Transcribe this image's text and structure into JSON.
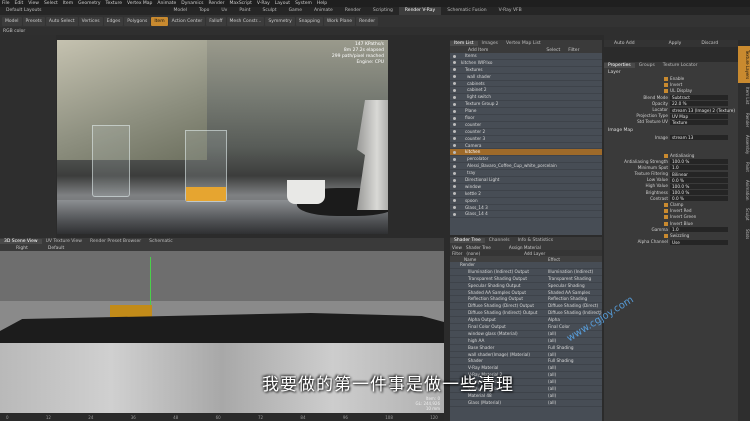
{
  "menubar": [
    "File",
    "Edit",
    "View",
    "Select",
    "Item",
    "Geometry",
    "Texture",
    "Vertex Map",
    "Animate",
    "Dynamics",
    "Render",
    "MaxScript",
    "V-Ray",
    "Layout",
    "System",
    "Help"
  ],
  "tabs": [
    "Model",
    "Topo",
    "Uv",
    "Paint",
    "Sculpt",
    "Game",
    "Animate",
    "Render",
    "Scripting",
    "Render V-Ray",
    "Schematic Fusion",
    "V-Ray VFB"
  ],
  "active_tab": "Render V-Ray",
  "layout_label": "Default Layouts",
  "toolbar": [
    {
      "label": "Model",
      "on": false
    },
    {
      "label": "Presets",
      "on": false
    },
    {
      "label": "Auto Select",
      "on": false
    },
    {
      "label": "Vertices",
      "on": false
    },
    {
      "label": "Edges",
      "on": false
    },
    {
      "label": "Polygons",
      "on": false
    },
    {
      "label": "Item",
      "on": true
    },
    {
      "label": "Action Center",
      "on": false
    },
    {
      "label": "Falloff",
      "on": false
    },
    {
      "label": "Mesh Constr...",
      "on": false
    },
    {
      "label": "Symmetry",
      "on": false
    },
    {
      "label": "Snapping",
      "on": false
    },
    {
      "label": "Work Plane",
      "on": false
    },
    {
      "label": "Render",
      "on": false
    }
  ],
  "left_label": "RGB color",
  "render_info": {
    "line1": "147 KPaths/s",
    "line2": "8m 27.2s elapsed",
    "line3": "299 path/pixel reached",
    "line4": "Engine: CPU"
  },
  "viewport_tabs": [
    "3D Scene View",
    "UV Texture View",
    "Render Preset Browser",
    "Schematic"
  ],
  "viewport_labels": {
    "view": "Right",
    "shading": "Default"
  },
  "viewport_stats": {
    "line1": "Item: 0",
    "line2": "GL: 244,926",
    "line3": "10 mm"
  },
  "ruler_ticks": [
    "0",
    "12",
    "24",
    "36",
    "48",
    "60",
    "72",
    "84",
    "96",
    "108",
    "120"
  ],
  "itemlist_tabs": [
    "Item List",
    "Images",
    "Vertex Map List"
  ],
  "itemlist_buttons": {
    "add": "Add Item",
    "select": "Select",
    "filter": "Filter"
  },
  "items": [
    {
      "name": "Items",
      "sel": false
    },
    {
      "name": "kitchen WIP.lxo",
      "sel": false
    },
    {
      "name": "Textures",
      "sel": false
    },
    {
      "name": "wall shader",
      "sel": false
    },
    {
      "name": "cabinets",
      "sel": false
    },
    {
      "name": "cabinet 2",
      "sel": false
    },
    {
      "name": "light switch",
      "sel": false
    },
    {
      "name": "Texture Group 2",
      "sel": false
    },
    {
      "name": "Plane",
      "sel": false
    },
    {
      "name": "floor",
      "sel": false
    },
    {
      "name": "counter",
      "sel": false
    },
    {
      "name": "counter 2",
      "sel": false
    },
    {
      "name": "counter 3",
      "sel": false
    },
    {
      "name": "Camera",
      "sel": false
    },
    {
      "name": "kitchen",
      "sel": true
    },
    {
      "name": "percolator",
      "sel": false
    },
    {
      "name": "Alessi_Bavaro_Coffee_Cup_white_porcelain",
      "sel": false
    },
    {
      "name": "tray",
      "sel": false
    },
    {
      "name": "Directional Light",
      "sel": false
    },
    {
      "name": "window",
      "sel": false
    },
    {
      "name": "kettle 2",
      "sel": false
    },
    {
      "name": "spoon",
      "sel": false
    },
    {
      "name": "Glass_14 3",
      "sel": false
    },
    {
      "name": "Glass_14 4",
      "sel": false
    }
  ],
  "shader_tabs": [
    "Shader Tree",
    "Channels",
    "Info & Statistics"
  ],
  "shader_toolbar": {
    "view": "View",
    "mode": "Shader Tree",
    "assign": "Assign Material",
    "filter": "Filter",
    "filter_value": "(none)",
    "add": "Add Layer"
  },
  "shader_columns": {
    "name": "Name",
    "effect": "Effect"
  },
  "shader_rows": [
    {
      "name": "Render",
      "effect": ""
    },
    {
      "name": "Illumination (Indirect) Output",
      "effect": "Illumination (Indirect)"
    },
    {
      "name": "Transparent Shading Output",
      "effect": "Transparent Shading"
    },
    {
      "name": "Specular Shading Output",
      "effect": "Specular Shading"
    },
    {
      "name": "Shaded AA Samples Output",
      "effect": "Shaded AA Samples"
    },
    {
      "name": "Reflection Shading Output",
      "effect": "Reflection Shading"
    },
    {
      "name": "Diffuse Shading (Direct) Output",
      "effect": "Diffuse Shading (Direct)"
    },
    {
      "name": "Diffuse Shading (Indirect) Output",
      "effect": "Diffuse Shading (Indirect)"
    },
    {
      "name": "Alpha Output",
      "effect": "Alpha"
    },
    {
      "name": "Final Color Output",
      "effect": "Final Color"
    },
    {
      "name": "window glass (Material)",
      "effect": "(all)"
    },
    {
      "name": "high AA",
      "effect": "(all)"
    },
    {
      "name": "Base Shader",
      "effect": "Full Shading"
    },
    {
      "name": "wall shader(Image) (Material)",
      "effect": "(all)"
    },
    {
      "name": "Shader",
      "effect": "Full Shading"
    },
    {
      "name": "V-Ray Material",
      "effect": "(all)"
    },
    {
      "name": "V-Ray Material 2",
      "effect": "(all)"
    },
    {
      "name": "V-Ray Material 3",
      "effect": "(all)"
    },
    {
      "name": "V-Ray Material 4",
      "effect": "(all)"
    },
    {
      "name": "Material 48",
      "effect": "(all)"
    },
    {
      "name": "Glass (Material)",
      "effect": "(all)"
    }
  ],
  "props_header": {
    "auto_add": "Auto Add",
    "apply": "Apply",
    "discard": "Discard"
  },
  "props_tabs": [
    "Properties",
    "Groups",
    "Texture Locator"
  ],
  "props_sections": {
    "layer": "Layer",
    "image_map": "Image Map"
  },
  "props": [
    {
      "label": "",
      "check": "Enable"
    },
    {
      "label": "",
      "check": "Invert"
    },
    {
      "label": "",
      "check": "UL Display"
    },
    {
      "label": "Blend Mode",
      "value": "Subtract"
    },
    {
      "label": "Opacity",
      "value": "22.0 %"
    },
    {
      "label": "Locator",
      "value": "stream 13 (Image) 2 (Texture)"
    },
    {
      "label": "Projection Type",
      "value": "UV Map"
    },
    {
      "label": "Std Texture UV",
      "value": "Texture"
    },
    {
      "label": "Image",
      "value": "stream 13"
    },
    {
      "label": "",
      "check": "Antialiasing"
    },
    {
      "label": "Antialiasing Strength",
      "value": "100.0 %"
    },
    {
      "label": "Minimum Spot",
      "value": "1.0"
    },
    {
      "label": "Texture Filtering",
      "value": "Bilinear"
    },
    {
      "label": "Low Value",
      "value": "0.0 %"
    },
    {
      "label": "High Value",
      "value": "100.0 %"
    },
    {
      "label": "Brightness",
      "value": "100.0 %"
    },
    {
      "label": "Contrast",
      "value": "0.0 %"
    },
    {
      "label": "",
      "check": "Clamp"
    },
    {
      "label": "",
      "check": "Invert Red"
    },
    {
      "label": "",
      "check": "Invert Green"
    },
    {
      "label": "",
      "check": "Invert Blue"
    },
    {
      "label": "Gamma",
      "value": "1.0"
    },
    {
      "label": "",
      "check": "Swizzling"
    },
    {
      "label": "Alpha Channel",
      "value": "Use"
    }
  ],
  "side_tabs": [
    "Texture Layers",
    "Item List",
    "Render",
    "Assembly",
    "Paint",
    "Animation",
    "Sculpt",
    "Stats"
  ],
  "subtitle": "我要做的第一件事是做一些清理",
  "watermark": "www.cgjoy.com"
}
